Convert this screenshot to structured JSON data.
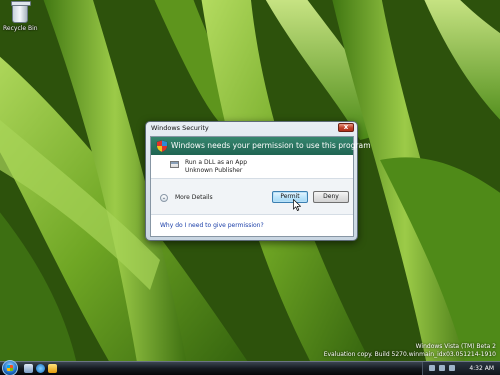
{
  "desktop": {
    "recycle_bin_label": "Recycle Bin",
    "watermark_line1": "Windows Vista (TM) Beta 2",
    "watermark_line2": "Evaluation copy. Build 5270.winmain_idx03.051214-1910"
  },
  "dialog": {
    "title": "Windows Security",
    "close_glyph": "x",
    "banner_text": "Windows needs your permission to use this program",
    "program_name": "Run a DLL as an App",
    "publisher": "Unknown Publisher",
    "more_details_label": "More Details",
    "expand_glyph": "⌄",
    "permit_label": "Permit",
    "deny_label": "Deny",
    "help_link": "Why do I need to give permission?"
  },
  "taskbar": {
    "clock": "4:32 AM"
  },
  "colors": {
    "banner": "#2a7561",
    "link": "#1a3ea8"
  },
  "icons": [
    "recycle-bin-icon",
    "shield-icon",
    "program-icon",
    "start-orb-icon",
    "mouse-cursor-icon"
  ]
}
